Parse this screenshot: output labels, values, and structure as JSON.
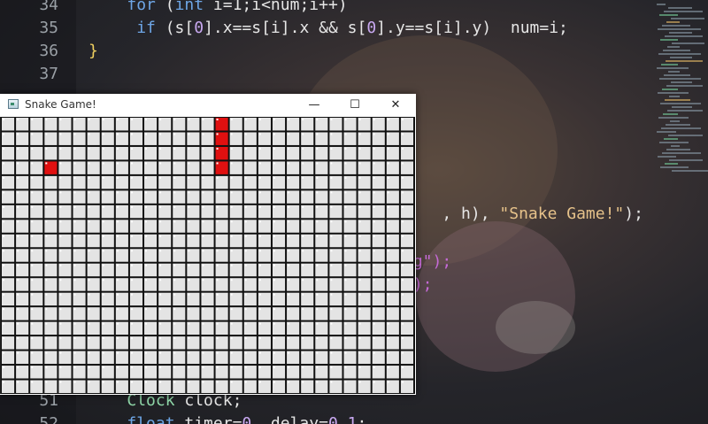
{
  "editor": {
    "lines": [
      {
        "n": "34",
        "parts": [
          {
            "t": "    "
          },
          {
            "t": "for",
            "c": "kw"
          },
          {
            "t": " ("
          },
          {
            "t": "int",
            "c": "kw"
          },
          {
            "t": " i=1;i<num;i++)"
          }
        ]
      },
      {
        "n": "35",
        "parts": [
          {
            "t": "     "
          },
          {
            "t": "if",
            "c": "kw"
          },
          {
            "t": " (s["
          },
          {
            "t": "0",
            "c": "num"
          },
          {
            "t": "].x==s[i].x && s["
          },
          {
            "t": "0",
            "c": "num"
          },
          {
            "t": "].y==s[i].y)  num=i;"
          }
        ]
      },
      {
        "n": "36",
        "parts": [
          {
            "t": "}",
            "c": "brace"
          }
        ]
      },
      {
        "n": "37",
        "parts": [
          {
            "t": ""
          }
        ]
      },
      {
        "n": "51",
        "parts": [
          {
            "t": "    "
          },
          {
            "t": "Clock",
            "c": "type"
          },
          {
            "t": " clock;"
          }
        ]
      },
      {
        "n": "52",
        "parts": [
          {
            "t": "    "
          },
          {
            "t": "float",
            "c": "kw"
          },
          {
            "t": " timer="
          },
          {
            "t": "0",
            "c": "num"
          },
          {
            "t": ", delay="
          },
          {
            "t": "0.1",
            "c": "num"
          },
          {
            "t": ";"
          }
        ]
      }
    ],
    "visible_fragments": [
      {
        "text": ", h), ",
        "c": ""
      },
      {
        "text": "\"Snake Game!\"",
        "c": "str"
      },
      {
        "text": ");",
        "c": ""
      },
      {
        "text": "ng\");",
        "c": "purple"
      },
      {
        "text": "\");",
        "c": "purple"
      }
    ]
  },
  "window": {
    "title": "Snake Game!",
    "buttons": {
      "minimize": "—",
      "maximize": "☐",
      "close": "✕"
    }
  },
  "game": {
    "cols": 29,
    "rows": 19,
    "snake": [
      [
        15,
        0
      ],
      [
        15,
        1
      ],
      [
        15,
        2
      ],
      [
        15,
        3
      ]
    ],
    "food": [
      [
        3,
        3
      ]
    ],
    "colors": {
      "tile": "#e4e4e4",
      "tile_border": "#1a1a1a",
      "snake": "#e01010",
      "food": "#e01010"
    }
  }
}
